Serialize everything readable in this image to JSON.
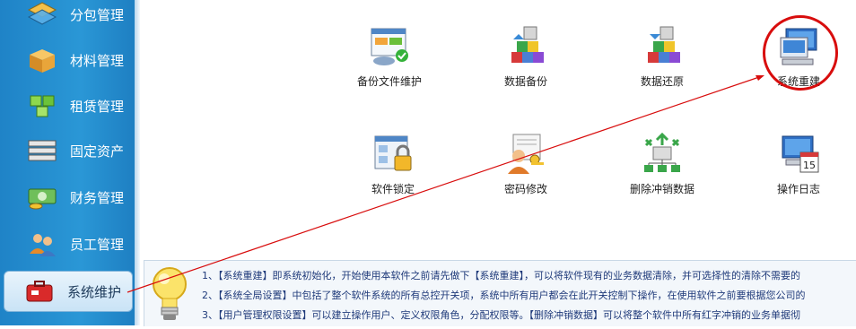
{
  "sidebar": {
    "items": [
      {
        "label": "分包管理",
        "icon": "layers-icon"
      },
      {
        "label": "材料管理",
        "icon": "box-icon"
      },
      {
        "label": "租赁管理",
        "icon": "cubes-icon"
      },
      {
        "label": "固定资产",
        "icon": "server-icon"
      },
      {
        "label": "财务管理",
        "icon": "money-icon"
      },
      {
        "label": "员工管理",
        "icon": "users-icon"
      },
      {
        "label": "系统维护",
        "icon": "toolbox-icon",
        "active": true
      }
    ]
  },
  "tiles": [
    {
      "label": "备份文件维护",
      "icon": "backup-files-icon"
    },
    {
      "label": "数据备份",
      "icon": "data-backup-icon"
    },
    {
      "label": "数据还原",
      "icon": "data-restore-icon"
    },
    {
      "label": "系统重建",
      "icon": "system-rebuild-icon",
      "highlighted": true
    },
    {
      "label": "软件锁定",
      "icon": "software-lock-icon"
    },
    {
      "label": "密码修改",
      "icon": "password-change-icon"
    },
    {
      "label": "删除冲销数据",
      "icon": "delete-reversal-icon"
    },
    {
      "label": "操作日志",
      "icon": "operation-log-icon",
      "badge": "15"
    }
  ],
  "info": {
    "lines": [
      "1、【系统重建】即系统初始化，开始使用本软件之前请先做下【系统重建】，可以将软件现有的业务数据清除，并可选择性的清除不需要的",
      "2、【系统全局设置】中包括了整个软件系统的所有总控开关项，系统中所有用户都会在此开关控制下操作，在使用软件之前要根据您公司的",
      "3、【用户管理权限设置】可以建立操作用户、定义权限角色，分配权限等。【删除冲销数据】可以将整个软件中所有红字冲销的业务单据彻"
    ]
  },
  "colors": {
    "sidebar": "#2a97d6",
    "highlight": "#d80d0d",
    "info_text": "#1f3a7a"
  }
}
